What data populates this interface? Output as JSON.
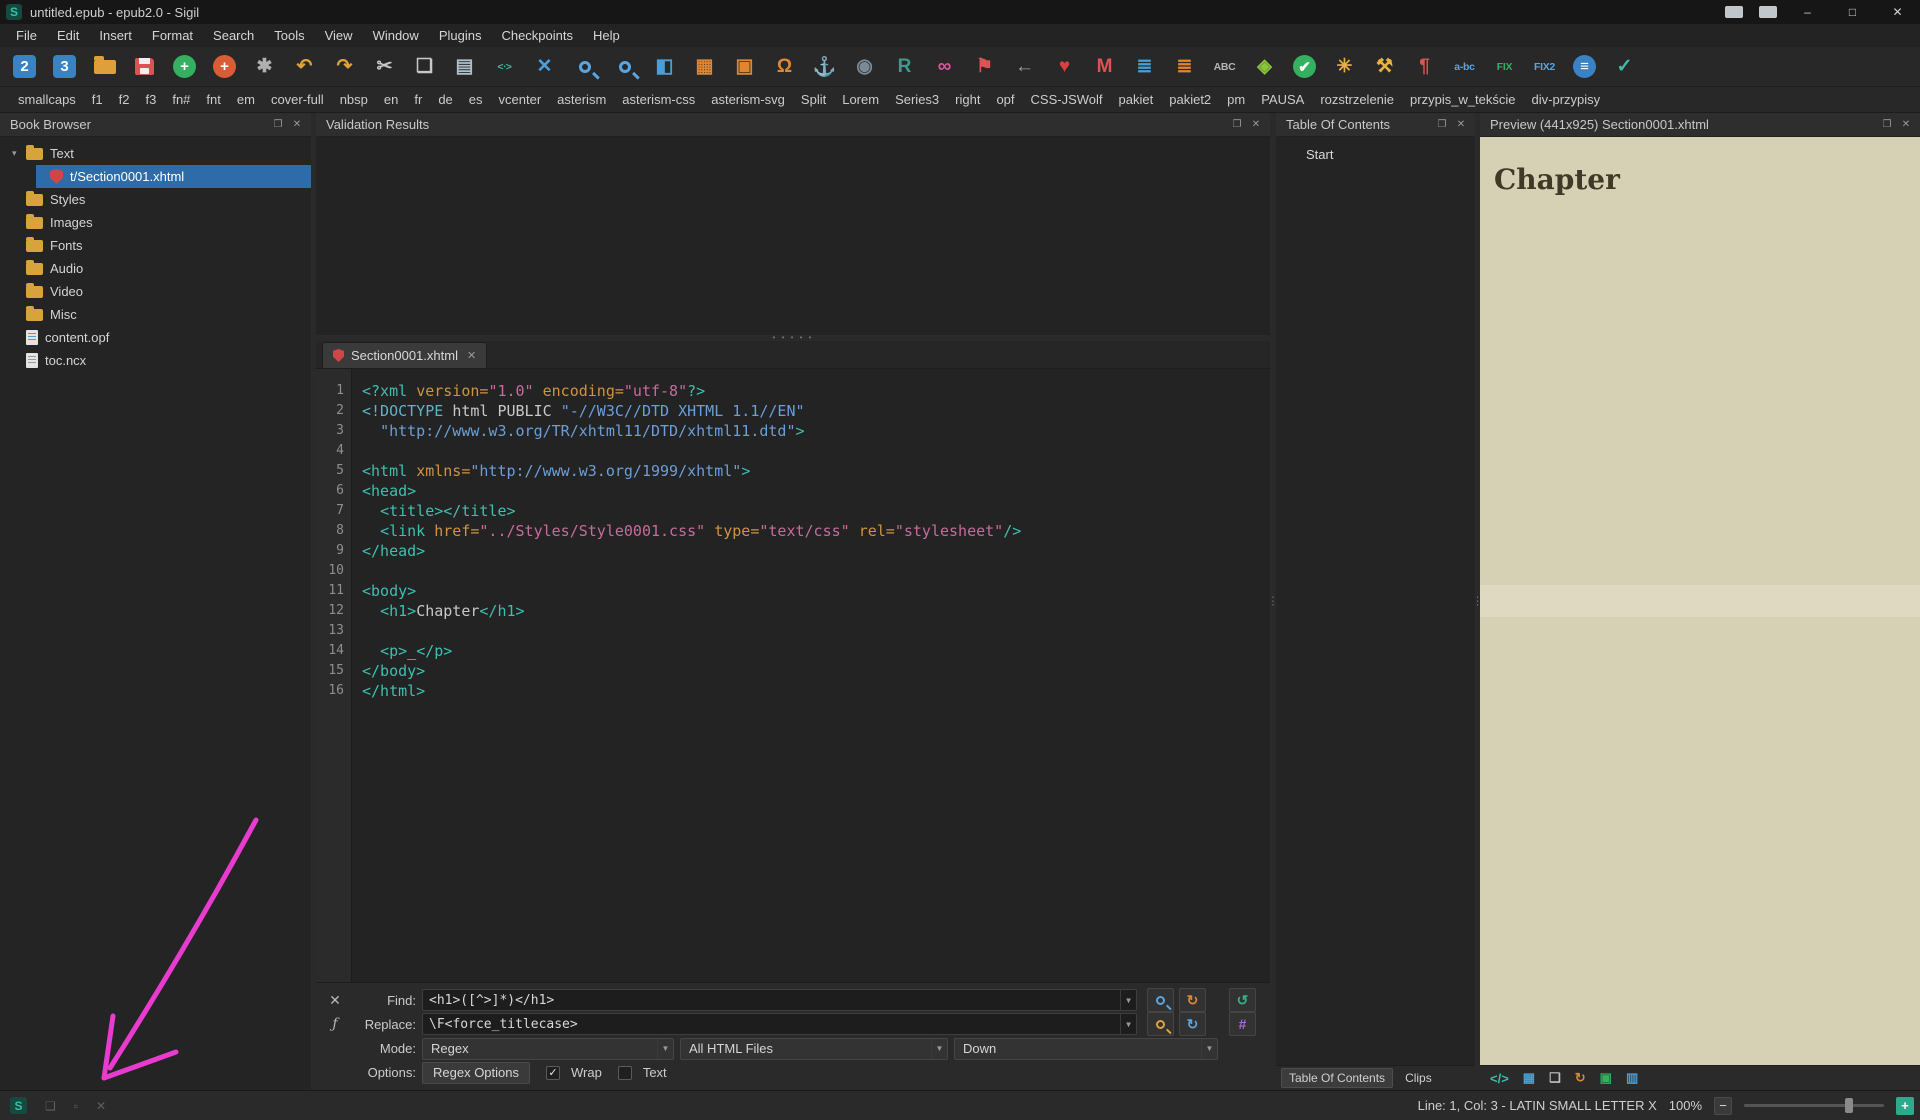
{
  "window": {
    "title": "untitled.epub - epub2.0 - Sigil",
    "minimize": "–",
    "maximize": "□",
    "close": "✕"
  },
  "icons": {
    "undock": "❐",
    "close": "✕",
    "combo": "▼",
    "tree_arrow": "▾",
    "dots_h": "• • • • •",
    "dots_v": "⋮",
    "fx": "ƒ",
    "check": "✓"
  },
  "menu": {
    "items": [
      "File",
      "Edit",
      "Insert",
      "Format",
      "Search",
      "Tools",
      "View",
      "Window",
      "Plugins",
      "Checkpoints",
      "Help"
    ]
  },
  "toolbar": {
    "icons": [
      {
        "name": "new-epub2-icon",
        "glyph": "2",
        "fg": "#ffffff",
        "bg": "#3b82c4"
      },
      {
        "name": "new-epub3-icon",
        "glyph": "3",
        "fg": "#ffffff",
        "bg": "#3b82c4"
      },
      {
        "name": "open-book-icon",
        "shape": "folder",
        "fg": "#dfa03b"
      },
      {
        "name": "save-icon",
        "shape": "floppy",
        "fg": "#d85555"
      },
      {
        "name": "add-file-icon",
        "glyph": "+",
        "fg": "#ffffff",
        "bg": "#35b060",
        "round": true
      },
      {
        "name": "add-existing-icon",
        "glyph": "+",
        "fg": "#ffffff",
        "bg": "#d85c35",
        "round": true
      },
      {
        "name": "settings-gear-icon",
        "glyph": "✱",
        "fg": "#b0b0b0"
      },
      {
        "name": "undo-icon",
        "glyph": "↶",
        "fg": "#e0a33a"
      },
      {
        "name": "redo-icon",
        "glyph": "↷",
        "fg": "#e0a33a"
      },
      {
        "name": "cut-icon",
        "glyph": "✂",
        "fg": "#c8c8c8"
      },
      {
        "name": "copy-icon",
        "glyph": "❏",
        "fg": "#c8c8c8"
      },
      {
        "name": "paste-icon",
        "glyph": "▤",
        "fg": "#aebfc9"
      },
      {
        "name": "code-view-icon",
        "glyph": "<∙>",
        "fg": "#3cbfa8",
        "small": true
      },
      {
        "name": "delete-x-icon",
        "glyph": "✕",
        "fg": "#4a9fd8"
      },
      {
        "name": "find-icon",
        "shape": "mag",
        "fg": "#5aa5e0"
      },
      {
        "name": "zoom-find-icon",
        "shape": "mag",
        "fg": "#5aa5e0"
      },
      {
        "name": "split-view-icon",
        "glyph": "◧",
        "fg": "#4a9fd8"
      },
      {
        "name": "insert-table-icon",
        "glyph": "▦",
        "fg": "#e0862e"
      },
      {
        "name": "insert-image-icon",
        "glyph": "▣",
        "fg": "#e0862e"
      },
      {
        "name": "special-characters-icon",
        "glyph": "Ω",
        "fg": "#e0862e"
      },
      {
        "name": "anchor-icon",
        "glyph": "⚓",
        "fg": "#3cbfc6"
      },
      {
        "name": "metadata-compass-icon",
        "glyph": "◉",
        "fg": "#7a8a96"
      },
      {
        "name": "reports-icon",
        "glyph": "R",
        "fg": "#3d9a8a"
      },
      {
        "name": "insert-link-icon",
        "glyph": "∞",
        "fg": "#e055a0"
      },
      {
        "name": "bookmark-icon",
        "glyph": "⚑",
        "fg": "#d85555"
      },
      {
        "name": "back-arrow-icon",
        "glyph": "←",
        "fg": "#9aa0a6"
      },
      {
        "name": "donate-heart-icon",
        "glyph": "♥",
        "fg": "#e03e3e"
      },
      {
        "name": "mail-icon",
        "glyph": "M",
        "fg": "#e05252"
      },
      {
        "name": "toc-list-icon",
        "glyph": "≣",
        "fg": "#4a9fd8"
      },
      {
        "name": "generate-toc-icon",
        "glyph": "≣",
        "fg": "#e0862e"
      },
      {
        "name": "spellcheck-icon",
        "glyph": "ABC",
        "fg": "#b5b5b5",
        "small": true
      },
      {
        "name": "wellformed-check-icon",
        "glyph": "◈",
        "fg": "#8ac63d"
      },
      {
        "name": "validate-check-icon",
        "glyph": "✔",
        "fg": "#ffffff",
        "bg": "#35b060",
        "round": true
      },
      {
        "name": "clean-sparkle-icon",
        "glyph": "✳",
        "fg": "#e8b33d"
      },
      {
        "name": "repair-wrench-icon",
        "glyph": "⚒",
        "fg": "#e8b33d"
      },
      {
        "name": "pilcrow-icon",
        "glyph": "¶",
        "fg": "#d85555"
      },
      {
        "name": "hyphenate-icon",
        "glyph": "a-bc",
        "fg": "#5aa5e0",
        "small": true
      },
      {
        "name": "fix-icon",
        "glyph": "FIX",
        "fg": "#35b060",
        "small": true
      },
      {
        "name": "fix2-icon",
        "glyph": "FIX2",
        "fg": "#5aa5e0",
        "small": true
      },
      {
        "name": "reflow-lines-icon",
        "glyph": "≡",
        "fg": "#ffffff",
        "bg": "#3b82c4",
        "round": true
      },
      {
        "name": "tidy-check-icon",
        "glyph": "✓",
        "fg": "#3cbfa8"
      }
    ],
    "text_buttons": [
      "smallcaps",
      "f1",
      "f2",
      "f3",
      "fn#",
      "fnt",
      "em",
      "cover-full",
      "nbsp",
      "en",
      "fr",
      "de",
      "es",
      "vcenter",
      "asterism",
      "asterism-css",
      "asterism-svg",
      "Split",
      "Lorem",
      "Series3",
      "right",
      "opf",
      "CSS-JSWolf",
      "pakiet",
      "pakiet2",
      "pm",
      "PAUSA",
      "rozstrzelenie",
      "przypis_w_tekście",
      "div-przypisy"
    ]
  },
  "book_browser": {
    "title": "Book Browser",
    "items": [
      {
        "label": "Text",
        "type": "folder",
        "arrow": true
      },
      {
        "label": "t/Section0001.xhtml",
        "type": "shield",
        "indent": 1,
        "selected": true
      },
      {
        "label": "Styles",
        "type": "folder"
      },
      {
        "label": "Images",
        "type": "folder"
      },
      {
        "label": "Fonts",
        "type": "folder"
      },
      {
        "label": "Audio",
        "type": "folder"
      },
      {
        "label": "Video",
        "type": "folder"
      },
      {
        "label": "Misc",
        "type": "folder"
      },
      {
        "label": "content.opf",
        "type": "opf"
      },
      {
        "label": "toc.ncx",
        "type": "doc"
      }
    ]
  },
  "validation": {
    "title": "Validation Results"
  },
  "editor": {
    "tab_label": "Section0001.xhtml",
    "lines": [
      {
        "n": 1,
        "seg": [
          [
            "tag",
            "<?xml "
          ],
          [
            "attr",
            "version="
          ],
          [
            "str",
            "\"1.0\""
          ],
          [
            "pln",
            " "
          ],
          [
            "attr",
            "encoding="
          ],
          [
            "str",
            "\"utf-8\""
          ],
          [
            "tag",
            "?>"
          ]
        ]
      },
      {
        "n": 2,
        "seg": [
          [
            "doct",
            "<!DOCTYPE "
          ],
          [
            "pln",
            "html PUBLIC "
          ],
          [
            "dstr",
            "\"-//W3C//DTD XHTML 1.1//EN\""
          ]
        ]
      },
      {
        "n": 3,
        "seg": [
          [
            "pln",
            "  "
          ],
          [
            "dstr",
            "\"http://www.w3.org/TR/xhtml11/DTD/xhtml11.dtd\""
          ],
          [
            "tag",
            ">"
          ]
        ]
      },
      {
        "n": 4,
        "seg": []
      },
      {
        "n": 5,
        "seg": [
          [
            "tag",
            "<html "
          ],
          [
            "attr",
            "xmlns="
          ],
          [
            "dstr",
            "\"http://www.w3.org/1999/xhtml\""
          ],
          [
            "tag",
            ">"
          ]
        ]
      },
      {
        "n": 6,
        "seg": [
          [
            "tag",
            "<head>"
          ]
        ]
      },
      {
        "n": 7,
        "seg": [
          [
            "pln",
            "  "
          ],
          [
            "tag",
            "<title></title>"
          ]
        ]
      },
      {
        "n": 8,
        "seg": [
          [
            "pln",
            "  "
          ],
          [
            "tag",
            "<link "
          ],
          [
            "attr",
            "href="
          ],
          [
            "str",
            "\"../Styles/Style0001.css\""
          ],
          [
            "pln",
            " "
          ],
          [
            "attr",
            "type="
          ],
          [
            "str",
            "\"text/css\""
          ],
          [
            "pln",
            " "
          ],
          [
            "attr",
            "rel="
          ],
          [
            "str",
            "\"stylesheet\""
          ],
          [
            "tag",
            "/>"
          ]
        ]
      },
      {
        "n": 9,
        "seg": [
          [
            "tag",
            "</head>"
          ]
        ]
      },
      {
        "n": 10,
        "seg": []
      },
      {
        "n": 11,
        "seg": [
          [
            "tag",
            "<body>"
          ]
        ]
      },
      {
        "n": 12,
        "seg": [
          [
            "pln",
            "  "
          ],
          [
            "tag",
            "<h1>"
          ],
          [
            "pln",
            "Chapter"
          ],
          [
            "tag",
            "</h1>"
          ]
        ]
      },
      {
        "n": 13,
        "seg": []
      },
      {
        "n": 14,
        "seg": [
          [
            "pln",
            "  "
          ],
          [
            "tag",
            "<p>"
          ],
          [
            "pln",
            "_"
          ],
          [
            "tag",
            "</p>"
          ]
        ]
      },
      {
        "n": 15,
        "seg": [
          [
            "tag",
            "</body>"
          ]
        ]
      },
      {
        "n": 16,
        "seg": [
          [
            "tag",
            "</html>"
          ]
        ]
      }
    ]
  },
  "findbar": {
    "find_label": "Find:",
    "find_value": "<h1>([^>]*)</h1>",
    "replace_label": "Replace:",
    "replace_value": "\\F<force_titlecase>",
    "mode_label": "Mode:",
    "mode_value": "Regex",
    "files_value": "All HTML Files",
    "direction_value": "Down",
    "options_label": "Options:",
    "regex_options_label": "Regex Options",
    "wrap_label": "Wrap",
    "text_label": "Text",
    "find_buttons": [
      {
        "name": "find-next-button",
        "shape": "mag",
        "fg": "#5aa5e0"
      },
      {
        "name": "replace-current-button",
        "glyph": "↻",
        "fg": "#e0862e"
      },
      {
        "name": "restart-find-button",
        "glyph": "↺",
        "fg": "#35b088",
        "gap": true
      }
    ],
    "replace_buttons": [
      {
        "name": "replace-next-button",
        "shape": "mag",
        "fg": "#e0a33a"
      },
      {
        "name": "replace-all-button",
        "glyph": "↻",
        "fg": "#5aa5e0"
      },
      {
        "name": "count-all-button",
        "glyph": "#",
        "fg": "#a86ad8",
        "gap": true
      }
    ]
  },
  "toc": {
    "title": "Table Of Contents",
    "items": [
      "Start"
    ],
    "tabs": [
      "Table Of Contents",
      "Clips"
    ]
  },
  "preview": {
    "title": "Preview (441x925) Section0001.xhtml",
    "heading": "Chapter",
    "icons": [
      {
        "name": "code-view-icon",
        "glyph": "</>",
        "fg": "#3cbfa8"
      },
      {
        "name": "inspect-icon",
        "glyph": "▦",
        "fg": "#4a9fd8"
      },
      {
        "name": "copy-icon",
        "glyph": "❏",
        "fg": "#c0c0c0"
      },
      {
        "name": "refresh-icon",
        "glyph": "↻",
        "fg": "#e0862e"
      },
      {
        "name": "image-icon",
        "glyph": "▣",
        "fg": "#35b060"
      },
      {
        "name": "print-icon",
        "glyph": "▥",
        "fg": "#4a9fd8"
      }
    ]
  },
  "status": {
    "left_icons": [
      {
        "name": "sigil-logo-icon",
        "glyph": "S",
        "cls": "sb-logo"
      },
      {
        "name": "plugin-icon",
        "glyph": "❏",
        "cls": "sb-dim"
      },
      {
        "name": "checkpoint-icon",
        "glyph": "▫",
        "cls": "sb-dim"
      },
      {
        "name": "clear-icon",
        "glyph": "✕",
        "cls": "sb-dim"
      }
    ],
    "cursor_text": "Line: 1, Col: 3 - LATIN SMALL LETTER X",
    "zoom_text": "100%",
    "zoom_minus": "−",
    "zoom_plus": "+"
  },
  "annotation": {
    "color": "#ea3bd0"
  }
}
